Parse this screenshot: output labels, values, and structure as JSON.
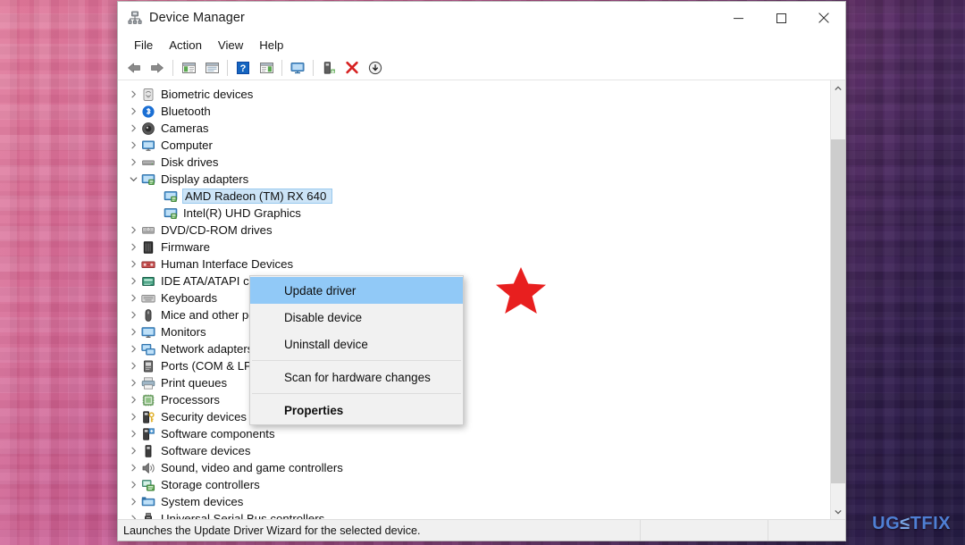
{
  "window": {
    "title": "Device Manager",
    "app_icon": "device-manager-icon",
    "controls": {
      "minimize": "minimize-icon",
      "maximize": "maximize-icon",
      "close": "close-icon"
    }
  },
  "menubar": {
    "items": [
      {
        "label": "File"
      },
      {
        "label": "Action"
      },
      {
        "label": "View"
      },
      {
        "label": "Help"
      }
    ]
  },
  "toolbar": {
    "buttons": [
      {
        "name": "back-icon"
      },
      {
        "name": "forward-icon"
      },
      {
        "name": "show-hide-console-tree-icon"
      },
      {
        "name": "properties-icon"
      },
      {
        "name": "help-icon"
      },
      {
        "name": "show-hide-action-pane-icon"
      },
      {
        "name": "scan-for-hardware-changes-icon"
      },
      {
        "name": "update-driver-icon"
      },
      {
        "name": "uninstall-device-icon"
      },
      {
        "name": "disable-device-icon"
      }
    ]
  },
  "tree": {
    "items": [
      {
        "label": "Biometric devices",
        "icon": "fingerprint-icon",
        "indent": 0,
        "expanded": false,
        "selected": false
      },
      {
        "label": "Bluetooth",
        "icon": "bluetooth-icon",
        "indent": 0,
        "expanded": false,
        "selected": false
      },
      {
        "label": "Cameras",
        "icon": "camera-icon",
        "indent": 0,
        "expanded": false,
        "selected": false
      },
      {
        "label": "Computer",
        "icon": "computer-icon",
        "indent": 0,
        "expanded": false,
        "selected": false
      },
      {
        "label": "Disk drives",
        "icon": "disk-drive-icon",
        "indent": 0,
        "expanded": false,
        "selected": false
      },
      {
        "label": "Display adapters",
        "icon": "display-adapter-icon",
        "indent": 0,
        "expanded": true,
        "selected": false
      },
      {
        "label": "AMD Radeon (TM) RX 640",
        "icon": "display-adapter-icon",
        "indent": 1,
        "expanded": null,
        "selected": true
      },
      {
        "label": "Intel(R) UHD Graphics",
        "icon": "display-adapter-icon",
        "indent": 1,
        "expanded": null,
        "selected": false
      },
      {
        "label": "DVD/CD-ROM drives",
        "icon": "dvd-drive-icon",
        "indent": 0,
        "expanded": false,
        "selected": false
      },
      {
        "label": "Firmware",
        "icon": "firmware-icon",
        "indent": 0,
        "expanded": false,
        "selected": false
      },
      {
        "label": "Human Interface Devices",
        "icon": "hid-icon",
        "indent": 0,
        "expanded": false,
        "selected": false
      },
      {
        "label": "IDE ATA/ATAPI controllers",
        "icon": "ide-controller-icon",
        "indent": 0,
        "expanded": false,
        "selected": false
      },
      {
        "label": "Keyboards",
        "icon": "keyboard-icon",
        "indent": 0,
        "expanded": false,
        "selected": false
      },
      {
        "label": "Mice and other pointing devices",
        "icon": "mouse-icon",
        "indent": 0,
        "expanded": false,
        "selected": false
      },
      {
        "label": "Monitors",
        "icon": "monitor-icon",
        "indent": 0,
        "expanded": false,
        "selected": false
      },
      {
        "label": "Network adapters",
        "icon": "network-adapter-icon",
        "indent": 0,
        "expanded": false,
        "selected": false
      },
      {
        "label": "Ports (COM & LPT)",
        "icon": "port-icon",
        "indent": 0,
        "expanded": false,
        "selected": false
      },
      {
        "label": "Print queues",
        "icon": "printer-icon",
        "indent": 0,
        "expanded": false,
        "selected": false
      },
      {
        "label": "Processors",
        "icon": "processor-icon",
        "indent": 0,
        "expanded": false,
        "selected": false
      },
      {
        "label": "Security devices",
        "icon": "security-device-icon",
        "indent": 0,
        "expanded": false,
        "selected": false
      },
      {
        "label": "Software components",
        "icon": "software-component-icon",
        "indent": 0,
        "expanded": false,
        "selected": false
      },
      {
        "label": "Software devices",
        "icon": "software-device-icon",
        "indent": 0,
        "expanded": false,
        "selected": false
      },
      {
        "label": "Sound, video and game controllers",
        "icon": "sound-icon",
        "indent": 0,
        "expanded": false,
        "selected": false
      },
      {
        "label": "Storage controllers",
        "icon": "storage-controller-icon",
        "indent": 0,
        "expanded": false,
        "selected": false
      },
      {
        "label": "System devices",
        "icon": "system-device-icon",
        "indent": 0,
        "expanded": false,
        "selected": false
      },
      {
        "label": "Universal Serial Bus controllers",
        "icon": "usb-controller-icon",
        "indent": 0,
        "expanded": false,
        "selected": false
      }
    ]
  },
  "context_menu": {
    "items": [
      {
        "label": "Update driver",
        "highlighted": true,
        "bold": false,
        "separator_after": false
      },
      {
        "label": "Disable device",
        "highlighted": false,
        "bold": false,
        "separator_after": false
      },
      {
        "label": "Uninstall device",
        "highlighted": false,
        "bold": false,
        "separator_after": true
      },
      {
        "label": "Scan for hardware changes",
        "highlighted": false,
        "bold": false,
        "separator_after": true
      },
      {
        "label": "Properties",
        "highlighted": false,
        "bold": true,
        "separator_after": false
      }
    ]
  },
  "annotation": {
    "name": "red-star-marker",
    "color": "#e81f1f"
  },
  "statusbar": {
    "message": "Launches the Update Driver Wizard for the selected device.",
    "panel2": "",
    "panel3": ""
  },
  "watermark": {
    "prefix": "UG",
    "mid": "≤",
    "suffix": "TFIX"
  },
  "colors": {
    "selection_blue": "#cce4f7",
    "menu_highlight": "#91c9f7",
    "star_red": "#e81f1f",
    "watermark_blue": "#4f7fd4"
  }
}
